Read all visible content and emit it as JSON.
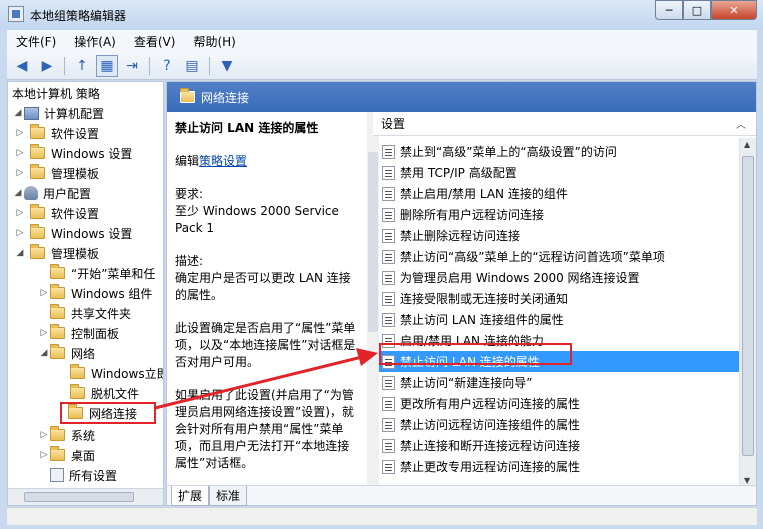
{
  "window": {
    "title": "本地组策略编辑器",
    "min": "─",
    "max": "□",
    "close": "✕"
  },
  "menu": [
    "文件(F)",
    "操作(A)",
    "查看(V)",
    "帮助(H)"
  ],
  "toolbar": [
    "◀",
    "▶",
    "↑",
    "▦",
    "⇥",
    "?",
    "▤",
    "▼"
  ],
  "tree": {
    "root": "本地计算机 策略",
    "computer_config": "计算机配置",
    "software_settings_1": "软件设置",
    "windows_settings_1": "Windows 设置",
    "admin_templates_1": "管理模板",
    "user_config": "用户配置",
    "software_settings_2": "软件设置",
    "windows_settings_2": "Windows 设置",
    "admin_templates_2": "管理模板",
    "start_menu": "“开始”菜单和任",
    "windows_components": "Windows 组件",
    "shared_folders": "共享文件夹",
    "control_panel": "控制面板",
    "network": "网络",
    "windows_instant": "Windows立即",
    "offline_files": "脱机文件",
    "network_connections": "网络连接",
    "system": "系统",
    "desktop": "桌面",
    "all_settings": "所有设置"
  },
  "right_header": "网络连接",
  "desc": {
    "title": "禁止访问 LAN 连接的属性",
    "edit_prefix": "编辑",
    "edit_link": "策略设置",
    "req_label": "要求:",
    "req_text": "至少 Windows 2000 Service Pack 1",
    "desc_label": "描述:",
    "desc_text": "确定用户是否可以更改 LAN 连接的属性。",
    "para2": "此设置确定是否启用了“属性”菜单项，以及“本地连接属性”对话框是否对用户可用。",
    "para3": "如果启用了此设置(并启用了“为管理员启用网络连接设置”设置)，就会针对所有用户禁用“属性”菜单项，而且用户无法打开“本地连接属性”对话框。"
  },
  "list": {
    "header": "设置",
    "items": [
      "禁止到“高级”菜单上的“高级设置”的访问",
      "禁用 TCP/IP 高级配置",
      "禁止启用/禁用 LAN 连接的组件",
      "删除所有用户远程访问连接",
      "禁止删除远程访问连接",
      "禁止访问“高级”菜单上的“远程访问首选项”菜单项",
      "为管理员启用 Windows 2000 网络连接设置",
      "连接受限制或无连接时关闭通知",
      "禁止访问 LAN 连接组件的属性",
      "启用/禁用 LAN 连接的能力",
      "禁止访问 LAN 连接的属性",
      "禁止访问“新建连接向导”",
      "更改所有用户远程访问连接的属性",
      "禁止访问远程访问连接组件的属性",
      "禁止连接和断开连接远程访问连接",
      "禁止更改专用远程访问连接的属性"
    ],
    "selected_index": 10
  },
  "tabs": [
    "扩展",
    "标准"
  ]
}
